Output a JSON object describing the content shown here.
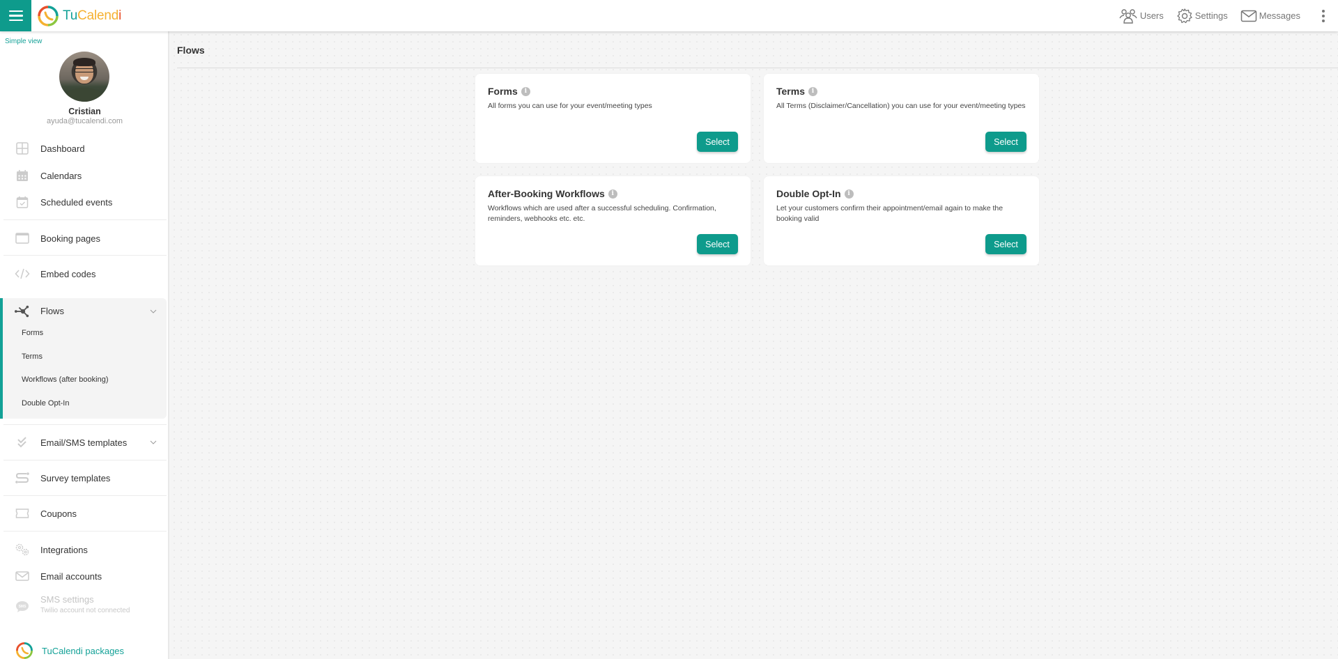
{
  "app": {
    "logo_parts": [
      "Tu",
      "Calend",
      "i"
    ],
    "brand_color": "#0e9b8c",
    "accent_colors": {
      "teal": "#13a197",
      "yellow": "#f5b131",
      "red": "#e8502c"
    }
  },
  "topbar": {
    "actions": [
      {
        "label": "Users",
        "icon": "users-icon"
      },
      {
        "label": "Settings",
        "icon": "gear-icon"
      },
      {
        "label": "Messages",
        "icon": "envelope-icon"
      }
    ],
    "more_icon": "kebab-menu-icon"
  },
  "sidebar": {
    "simple_view": "Simple view",
    "user": {
      "name": "Cristian",
      "email": "ayuda@tucalendi.com"
    },
    "items": [
      {
        "label": "Dashboard",
        "icon": "dashboard-grid-icon"
      },
      {
        "label": "Calendars",
        "icon": "calendar-icon"
      },
      {
        "label": "Scheduled events",
        "icon": "calendar-check-icon"
      },
      {
        "label": "Booking pages",
        "icon": "browser-window-icon"
      },
      {
        "label": "Embed codes",
        "icon": "code-icon"
      },
      {
        "label": "Flows",
        "icon": "flows-network-icon",
        "expanded": true,
        "active": true,
        "children": [
          {
            "label": "Forms"
          },
          {
            "label": "Terms"
          },
          {
            "label": "Workflows (after booking)"
          },
          {
            "label": "Double Opt-In"
          }
        ]
      },
      {
        "label": "Email/SMS templates",
        "icon": "double-check-icon",
        "expandable": true
      },
      {
        "label": "Survey templates",
        "icon": "survey-flow-icon"
      },
      {
        "label": "Coupons",
        "icon": "ticket-icon"
      },
      {
        "label": "Integrations",
        "icon": "gears-icon"
      },
      {
        "label": "Email accounts",
        "icon": "envelope-icon"
      },
      {
        "label": "SMS settings",
        "icon": "sms-bubble-icon",
        "disabled": true,
        "sublabel": "Twilio account not connected"
      }
    ],
    "packages": "TuCalendi packages"
  },
  "main": {
    "title": "Flows",
    "cards": [
      {
        "title": "Forms",
        "description": "All forms you can use for your event/meeting types",
        "button": "Select"
      },
      {
        "title": "Terms",
        "description": "All Terms (Disclaimer/Cancellation) you can use for your event/meeting types",
        "button": "Select"
      },
      {
        "title": "After-Booking Workflows",
        "description": "Workflows which are used after a successful scheduling. Confirmation, reminders, webhooks etc. etc.",
        "button": "Select"
      },
      {
        "title": "Double Opt-In",
        "description": "Let your customers confirm their appointment/email again to make the booking valid",
        "button": "Select"
      }
    ]
  }
}
